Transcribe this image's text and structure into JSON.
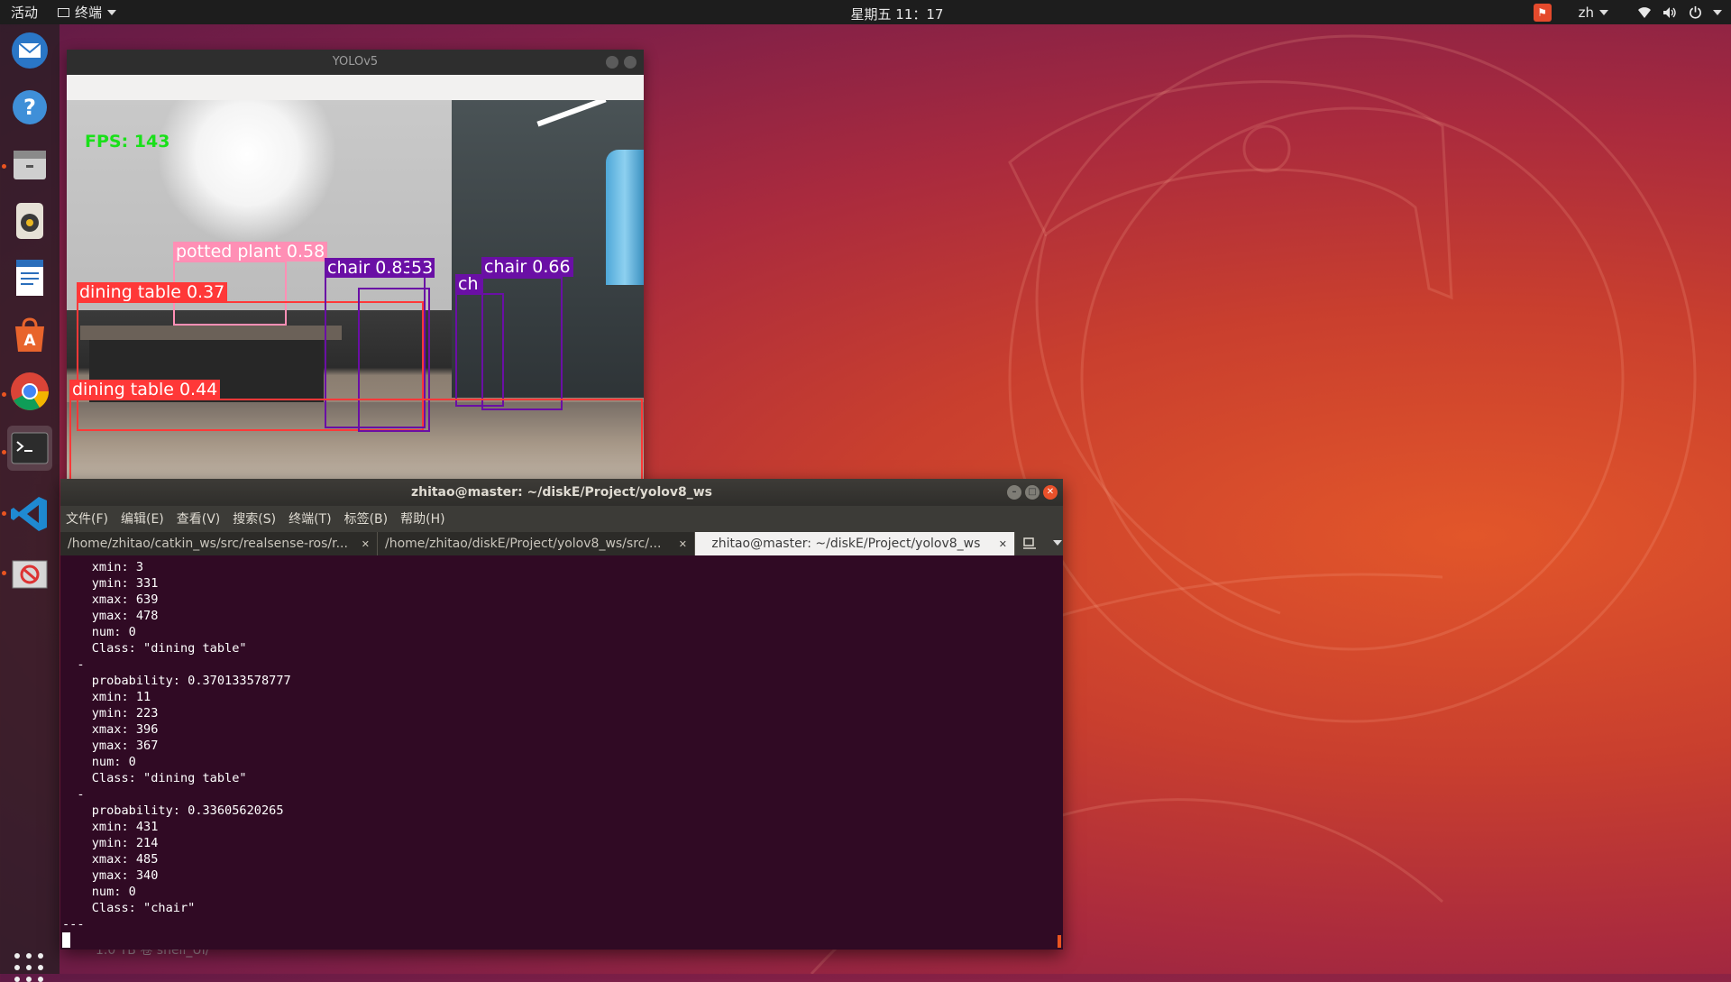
{
  "topbar": {
    "activities": "活动",
    "app_menu": "终端",
    "clock": "星期五 11：17",
    "input_method": "zh"
  },
  "dock": {
    "items": [
      "thunderbird-mail",
      "help",
      "files",
      "rhythmbox",
      "libreoffice-writer",
      "ubuntu-software",
      "google-chrome",
      "terminal",
      "visual-studio-code",
      "unknown-app"
    ]
  },
  "yolo_window": {
    "title": "YOLOv5",
    "fps_text": "FPS: 143",
    "detections": [
      {
        "label": "potted plant 0.58",
        "color": "#ff8fb5"
      },
      {
        "label": "dining table 0.37",
        "color": "#ff3838"
      },
      {
        "label": "chair 0.83",
        "color": "#6a0fa5"
      },
      {
        "label": "53",
        "color": "#6a0fa5"
      },
      {
        "label": "ch",
        "color": "#6a0fa5"
      },
      {
        "label": "chair 0.66",
        "color": "#6a0fa5"
      },
      {
        "label": "dining table 0.44",
        "color": "#ff3838"
      }
    ]
  },
  "terminal": {
    "title": "zhitao@master: ~/diskE/Project/yolov8_ws",
    "menu": [
      "文件(F)",
      "编辑(E)",
      "查看(V)",
      "搜索(S)",
      "终端(T)",
      "标签(B)",
      "帮助(H)"
    ],
    "tabs": [
      {
        "label": "/home/zhitao/catkin_ws/src/realsense-ros/r...",
        "active": false
      },
      {
        "label": "/home/zhitao/diskE/Project/yolov8_ws/src/...",
        "active": false
      },
      {
        "label": "zhitao@master: ~/diskE/Project/yolov8_ws",
        "active": true
      }
    ],
    "output": "    xmin: 3\n    ymin: 331\n    xmax: 639\n    ymax: 478\n    num: 0\n    Class: \"dining table\"\n  -\n    probability: 0.370133578777\n    xmin: 11\n    ymin: 223\n    xmax: 396\n    ymax: 367\n    num: 0\n    Class: \"dining table\"\n  -\n    probability: 0.33605620265\n    xmin: 431\n    ymin: 214\n    xmax: 485\n    ymax: 340\n    num: 0\n    Class: \"chair\"\n---",
    "behind_text": "1.0 TB 卷          shell_UI/"
  },
  "colors": {
    "topbar": "#1d1d1d",
    "terminal_bg": "#300a24",
    "accent": "#e95420"
  }
}
